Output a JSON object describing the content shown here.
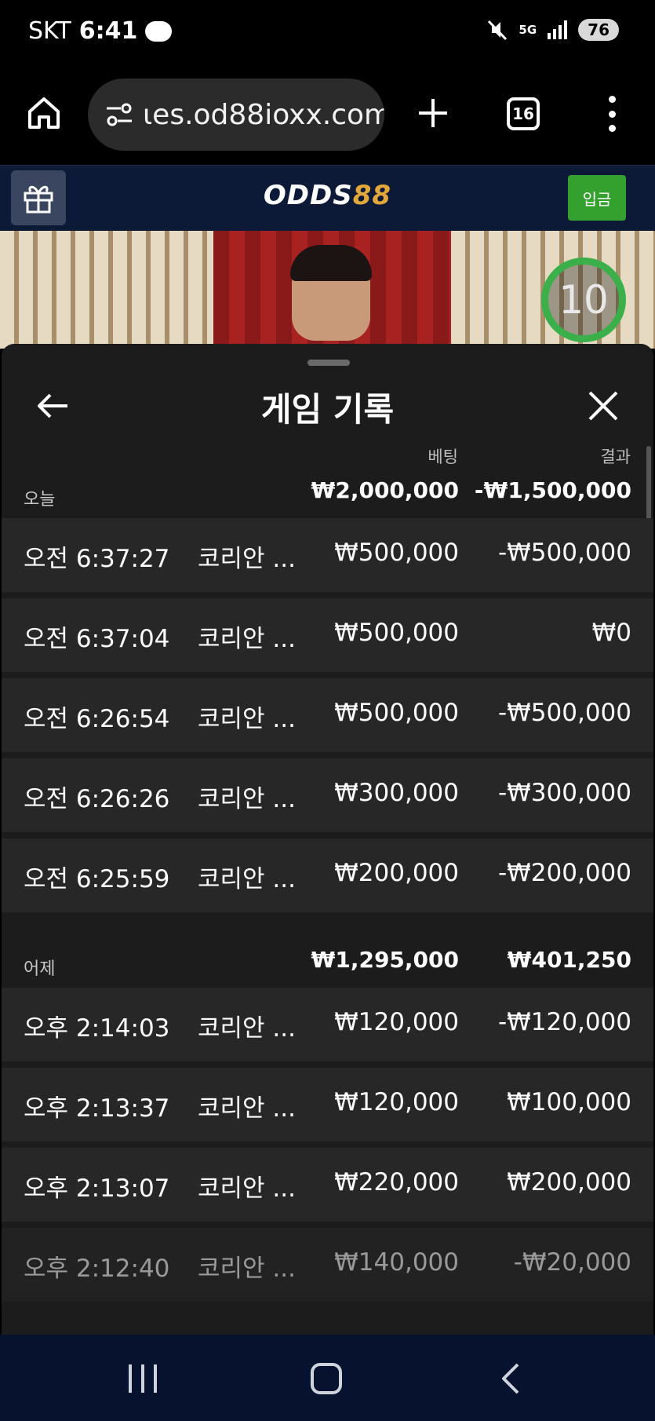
{
  "status_bar": {
    "carrier": "SKT",
    "time": "6:41",
    "network": "5G",
    "battery": "76"
  },
  "browser": {
    "url": "ιes.od88ioxx.com",
    "tab_count": "16"
  },
  "site": {
    "logo_text_white": "ODDS",
    "logo_text_accent": "88",
    "deposit_label": "입금",
    "accent_color": "#e3a83c",
    "deposit_color": "#34a12e"
  },
  "video": {
    "countdown": "10"
  },
  "modal": {
    "title": "게임 기록",
    "col_bet": "베팅",
    "col_result": "결과",
    "groups": [
      {
        "label": "오늘",
        "total_bet": "₩2,000,000",
        "total_result": "-₩1,500,000",
        "rows": [
          {
            "time": "오전 6:37:27",
            "game": "코리안 ...",
            "bet": "₩500,000",
            "result": "-₩500,000"
          },
          {
            "time": "오전 6:37:04",
            "game": "코리안 ...",
            "bet": "₩500,000",
            "result": "₩0"
          },
          {
            "time": "오전 6:26:54",
            "game": "코리안 ...",
            "bet": "₩500,000",
            "result": "-₩500,000"
          },
          {
            "time": "오전 6:26:26",
            "game": "코리안 ...",
            "bet": "₩300,000",
            "result": "-₩300,000"
          },
          {
            "time": "오전 6:25:59",
            "game": "코리안 ...",
            "bet": "₩200,000",
            "result": "-₩200,000"
          }
        ]
      },
      {
        "label": "어제",
        "total_bet": "₩1,295,000",
        "total_result": "₩401,250",
        "rows": [
          {
            "time": "오후 2:14:03",
            "game": "코리안 ...",
            "bet": "₩120,000",
            "result": "-₩120,000"
          },
          {
            "time": "오후 2:13:37",
            "game": "코리안 ...",
            "bet": "₩120,000",
            "result": "₩100,000"
          },
          {
            "time": "오후 2:13:07",
            "game": "코리안 ...",
            "bet": "₩220,000",
            "result": "₩200,000"
          },
          {
            "time": "오후 2:12:40",
            "game": "코리안 ...",
            "bet": "₩140,000",
            "result": "-₩20,000"
          }
        ]
      }
    ]
  }
}
